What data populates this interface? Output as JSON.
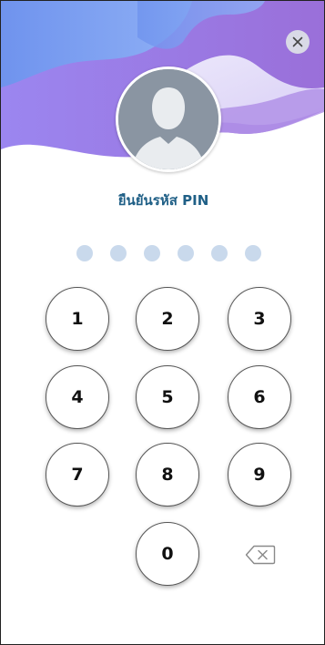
{
  "header": {
    "colors": {
      "blue": "#7d9bf0",
      "purple": "#a079e0",
      "lilac": "#c7b5f2"
    }
  },
  "close": {
    "icon": "close-icon"
  },
  "avatar": {
    "icon": "user-silhouette-icon"
  },
  "pin": {
    "title": "ยืนยันรหัส PIN",
    "length": 6,
    "entered": 0
  },
  "keypad": {
    "keys": [
      "1",
      "2",
      "3",
      "4",
      "5",
      "6",
      "7",
      "8",
      "9",
      "0"
    ],
    "backspace_icon": "backspace-icon"
  },
  "colors": {
    "title": "#1f5f86",
    "dot_empty": "#c9d9ec"
  }
}
